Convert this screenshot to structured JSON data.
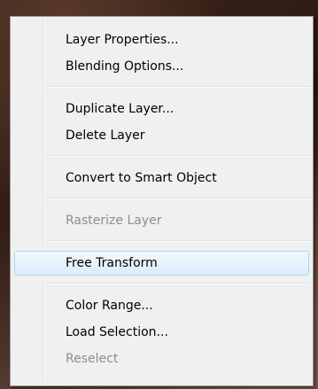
{
  "menu": {
    "items": [
      {
        "label": "Layer Properties...",
        "enabled": true
      },
      {
        "label": "Blending Options...",
        "enabled": true
      },
      {
        "label": "Duplicate Layer...",
        "enabled": true
      },
      {
        "label": "Delete Layer",
        "enabled": true
      },
      {
        "label": "Convert to Smart Object",
        "enabled": true
      },
      {
        "label": "Rasterize Layer",
        "enabled": false
      },
      {
        "label": "Free Transform",
        "enabled": true,
        "highlighted": true
      },
      {
        "label": "Color Range...",
        "enabled": true
      },
      {
        "label": "Load Selection...",
        "enabled": true
      },
      {
        "label": "Reselect",
        "enabled": false
      }
    ]
  },
  "colors": {
    "menu_background": "#f0f0f0",
    "disabled_text": "#8d8d8d",
    "highlight_border": "#a8d8f0",
    "highlight_fill": "#dcecfb"
  }
}
